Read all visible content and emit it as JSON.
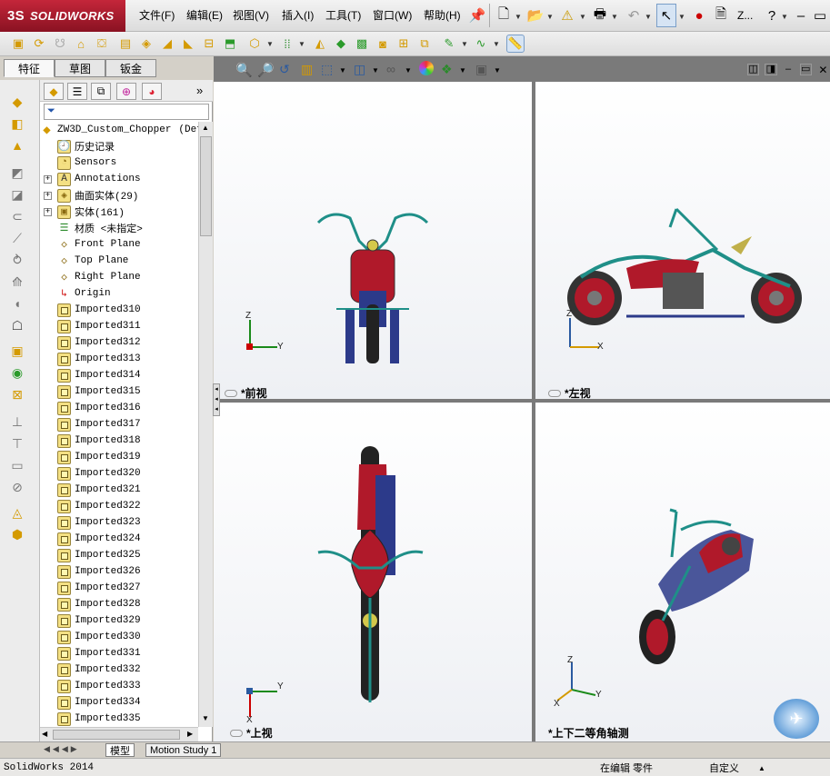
{
  "app": {
    "logo_text": "SOLIDWORKS",
    "logo_mark": "3S"
  },
  "menus": [
    "文件(F)",
    "编辑(E)",
    "视图(V)",
    "插入(I)",
    "工具(T)",
    "窗口(W)",
    "帮助(H)"
  ],
  "toolbar": {
    "user_label": "Z..."
  },
  "left_tabs": [
    "特征",
    "草图",
    "钣金"
  ],
  "tree": {
    "root": "ZW3D_Custom_Chopper",
    "root_suffix": "(Def",
    "items": [
      {
        "label": "历史记录",
        "icon": "history-icon",
        "expand": false
      },
      {
        "label": "Sensors",
        "icon": "sensor-icon",
        "expand": false
      },
      {
        "label": "Annotations",
        "icon": "annotation-icon",
        "expand": true
      },
      {
        "label": "曲面实体(29)",
        "icon": "surface-body-icon",
        "expand": true
      },
      {
        "label": "实体(161)",
        "icon": "solid-body-icon",
        "expand": true
      },
      {
        "label": "材质 <未指定>",
        "icon": "material-icon",
        "expand": false
      },
      {
        "label": "Front Plane",
        "icon": "plane-icon",
        "expand": false
      },
      {
        "label": "Top Plane",
        "icon": "plane-icon",
        "expand": false
      },
      {
        "label": "Right Plane",
        "icon": "plane-icon",
        "expand": false
      },
      {
        "label": "Origin",
        "icon": "origin-icon",
        "expand": false
      },
      {
        "label": "Imported310",
        "icon": "imported-feature-icon",
        "expand": false
      },
      {
        "label": "Imported311",
        "icon": "imported-feature-icon",
        "expand": false
      },
      {
        "label": "Imported312",
        "icon": "imported-feature-icon",
        "expand": false
      },
      {
        "label": "Imported313",
        "icon": "imported-feature-icon",
        "expand": false
      },
      {
        "label": "Imported314",
        "icon": "imported-feature-icon",
        "expand": false
      },
      {
        "label": "Imported315",
        "icon": "imported-feature-icon",
        "expand": false
      },
      {
        "label": "Imported316",
        "icon": "imported-feature-icon",
        "expand": false
      },
      {
        "label": "Imported317",
        "icon": "imported-feature-icon",
        "expand": false
      },
      {
        "label": "Imported318",
        "icon": "imported-feature-icon",
        "expand": false
      },
      {
        "label": "Imported319",
        "icon": "imported-feature-icon",
        "expand": false
      },
      {
        "label": "Imported320",
        "icon": "imported-feature-icon",
        "expand": false
      },
      {
        "label": "Imported321",
        "icon": "imported-feature-icon",
        "expand": false
      },
      {
        "label": "Imported322",
        "icon": "imported-feature-icon",
        "expand": false
      },
      {
        "label": "Imported323",
        "icon": "imported-feature-icon",
        "expand": false
      },
      {
        "label": "Imported324",
        "icon": "imported-feature-icon",
        "expand": false
      },
      {
        "label": "Imported325",
        "icon": "imported-feature-icon",
        "expand": false
      },
      {
        "label": "Imported326",
        "icon": "imported-feature-icon",
        "expand": false
      },
      {
        "label": "Imported327",
        "icon": "imported-feature-icon",
        "expand": false
      },
      {
        "label": "Imported328",
        "icon": "imported-feature-icon",
        "expand": false
      },
      {
        "label": "Imported329",
        "icon": "imported-feature-icon",
        "expand": false
      },
      {
        "label": "Imported330",
        "icon": "imported-feature-icon",
        "expand": false
      },
      {
        "label": "Imported331",
        "icon": "imported-feature-icon",
        "expand": false
      },
      {
        "label": "Imported332",
        "icon": "imported-feature-icon",
        "expand": false
      },
      {
        "label": "Imported333",
        "icon": "imported-feature-icon",
        "expand": false
      },
      {
        "label": "Imported334",
        "icon": "imported-feature-icon",
        "expand": false
      },
      {
        "label": "Imported335",
        "icon": "imported-feature-icon",
        "expand": false
      }
    ]
  },
  "views": {
    "front": "*前视",
    "left": "*左视",
    "top": "*上视",
    "iso": "*上下二等角轴测"
  },
  "axes": {
    "x": "X",
    "y": "Y",
    "z": "Z"
  },
  "bottom_tabs": [
    "模型",
    "Motion Study 1"
  ],
  "status": {
    "app": "SolidWorks 2014",
    "editing": "在编辑 零件",
    "custom": "自定义"
  },
  "colors": {
    "accent": "#c4263a",
    "frame": "#1f8f88",
    "body": "#b0192a",
    "engine": "#2c3a8a"
  }
}
